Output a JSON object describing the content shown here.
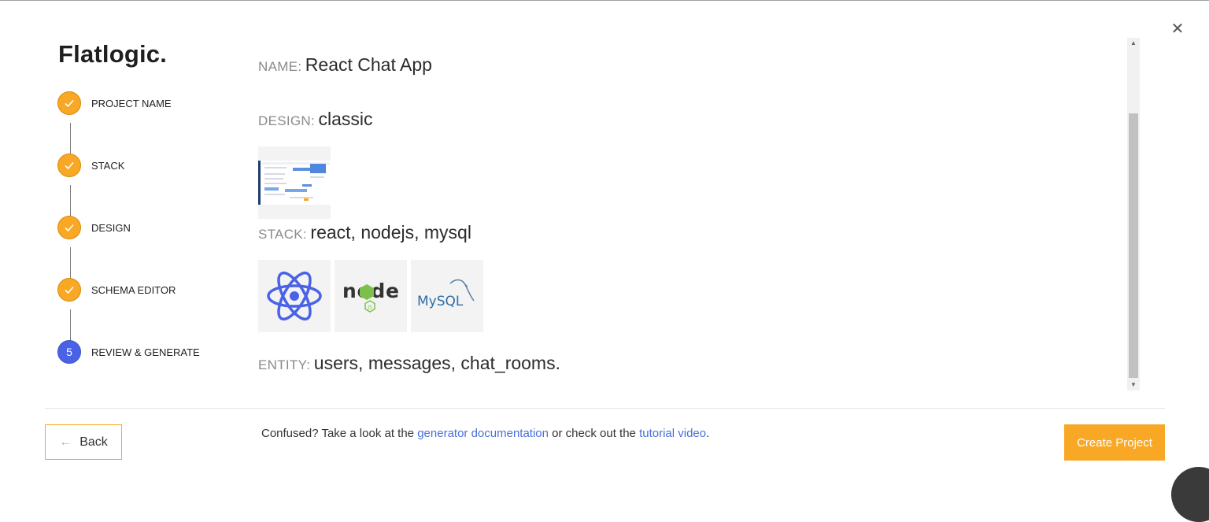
{
  "window": {
    "close_icon": "close-icon"
  },
  "brand": {
    "logo_text": "Flatlogic."
  },
  "steps": [
    {
      "label": "PROJECT NAME",
      "state": "completed",
      "icon": "check-icon"
    },
    {
      "label": "STACK",
      "state": "completed",
      "icon": "check-icon"
    },
    {
      "label": "DESIGN",
      "state": "completed",
      "icon": "check-icon"
    },
    {
      "label": "SCHEMA EDITOR",
      "state": "completed",
      "icon": "check-icon"
    },
    {
      "label": "REVIEW & GENERATE",
      "state": "active",
      "number": "5"
    }
  ],
  "review": {
    "name": {
      "key": "NAME:",
      "value": "React Chat App"
    },
    "design": {
      "key": "DESIGN:",
      "value": "classic",
      "thumbnail": "classic-design-preview"
    },
    "stack": {
      "key": "STACK:",
      "value": "react, nodejs, mysql",
      "logos": [
        "react-logo",
        "nodejs-logo",
        "mysql-logo"
      ],
      "node_logo_text": "node",
      "node_logo_badge": "JS",
      "mysql_logo_text": "MySQL"
    },
    "entity": {
      "key": "ENTITY:",
      "value": "users, messages, chat_rooms."
    }
  },
  "footer": {
    "back_label": "Back",
    "help_prefix": "Confused? Take a look at the ",
    "help_link1": "generator documentation",
    "help_middle": " or check out the ",
    "help_link2": "tutorial video",
    "help_suffix": ".",
    "create_label": "Create Project"
  },
  "colors": {
    "accent": "#f8a825",
    "active_step": "#4a63e6",
    "link": "#4a6fd8"
  }
}
